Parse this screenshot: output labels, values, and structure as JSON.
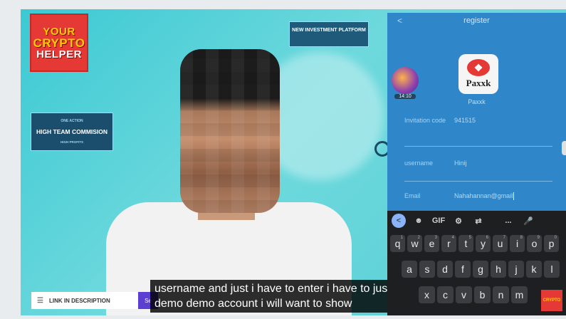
{
  "channel_logo": {
    "line1": "YOUR",
    "line2": "CRYPTO",
    "line3": "HELPER"
  },
  "badges": {
    "top": "NEW INVESTMENT PLATFORM",
    "left_small": "ONE ACTION",
    "left_big": "HIGH TEAM COMMISION",
    "left_tiny": "HIGH PROFITS"
  },
  "description_bar": {
    "icon": "menu-lines-icon",
    "label": "LINK IN DESCRIPTION",
    "tag": "Se"
  },
  "subtitle": "username and just i have to enter i have to just enter a demo demo account i will want to show",
  "phone": {
    "back_glyph": "<",
    "title": "register",
    "avatar_time": "14:10",
    "app_logo_word": "Paxxk",
    "app_name": "Paxxk",
    "fields": [
      {
        "label": "Invitation code",
        "value": "941515"
      },
      {
        "label": "username",
        "value": "Hinij"
      },
      {
        "label": "Email",
        "value": "Nahahannan@gmail"
      }
    ],
    "keyboard": {
      "toolbar": [
        "<",
        "sticker-icon",
        "GIF",
        "gear-icon",
        "translate-icon",
        "...",
        "mic-icon"
      ],
      "row1": [
        {
          "k": "q",
          "n": "1"
        },
        {
          "k": "w",
          "n": "2"
        },
        {
          "k": "e",
          "n": "3"
        },
        {
          "k": "r",
          "n": "4"
        },
        {
          "k": "t",
          "n": "5"
        },
        {
          "k": "y",
          "n": "6"
        },
        {
          "k": "u",
          "n": "7"
        },
        {
          "k": "i",
          "n": "8"
        },
        {
          "k": "o",
          "n": "9"
        },
        {
          "k": "p",
          "n": "0"
        }
      ],
      "row2": [
        "a",
        "s",
        "d",
        "f",
        "g",
        "h",
        "j",
        "k",
        "l"
      ],
      "row3": [
        "x",
        "c",
        "v",
        "b",
        "n",
        "m"
      ]
    }
  },
  "colors": {
    "phone_bg": "#2f86c9",
    "logo_red": "#e53935",
    "logo_yellow": "#ffcc00",
    "keyboard_bg": "#1e1f21"
  }
}
